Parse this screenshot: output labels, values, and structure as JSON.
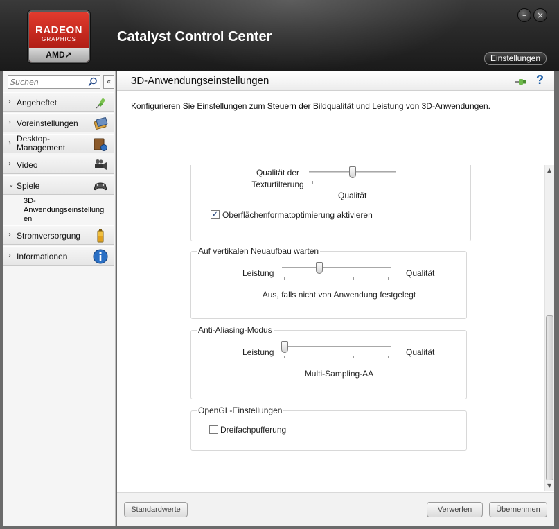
{
  "app": {
    "title": "Catalyst Control Center",
    "logo_radeon": "RADEON",
    "logo_graphics": "GRAPHICS",
    "logo_amd": "AMD↗",
    "settings_label": "Einstellungen",
    "minimize_glyph": "–",
    "close_glyph": "×"
  },
  "sidebar": {
    "search_placeholder": "Suchen",
    "collapse_glyph": "«",
    "items": [
      {
        "label": "Angeheftet",
        "icon": "pin-icon",
        "expanded": false
      },
      {
        "label": "Voreinstellungen",
        "icon": "presets-icon",
        "expanded": false
      },
      {
        "label": "Desktop-\nManagement",
        "icon": "desktop-management-icon",
        "expanded": false
      },
      {
        "label": "Video",
        "icon": "video-camera-icon",
        "expanded": false
      },
      {
        "label": "Spiele",
        "icon": "gamepad-icon",
        "expanded": true
      },
      {
        "label": "Stromversorgung",
        "icon": "battery-icon",
        "expanded": false
      },
      {
        "label": "Informationen",
        "icon": "info-icon",
        "expanded": false
      }
    ],
    "subitem": "3D-\nAnwendungseinstellung\nen",
    "chevron_right": "›",
    "chevron_down": "⌄"
  },
  "main": {
    "title": "3D-Anwendungseinstellungen",
    "help_glyph": "?",
    "description": "Konfigurieren Sie Einstellungen zum Steuern der Bildqualität und Leistung von 3D-Anwendungen.",
    "texture": {
      "label_line1": "Qualität der",
      "label_line2": "Texturfilterung",
      "value": "Qualität",
      "level": 0.5
    },
    "surface_checkbox": {
      "label": "Oberflächenformatoptimierung aktivieren",
      "checked": true,
      "glyph": "✓"
    },
    "vsync": {
      "title": "Auf vertikalen Neuaufbau warten",
      "left": "Leistung",
      "right": "Qualität",
      "value": "Aus, falls nicht von Anwendung festgelegt",
      "level": 0.333
    },
    "antialias": {
      "title": "Anti-Aliasing-Modus",
      "left": "Leistung",
      "right": "Qualität",
      "value": "Multi-Sampling-AA",
      "level": 0.0
    },
    "opengl": {
      "title": "OpenGL-Einstellungen",
      "checkbox_label": "Dreifachpufferung",
      "checked": false
    },
    "scroll_up": "▲",
    "scroll_down": "▼"
  },
  "footer": {
    "defaults": "Standardwerte",
    "discard": "Verwerfen",
    "apply": "Übernehmen"
  }
}
